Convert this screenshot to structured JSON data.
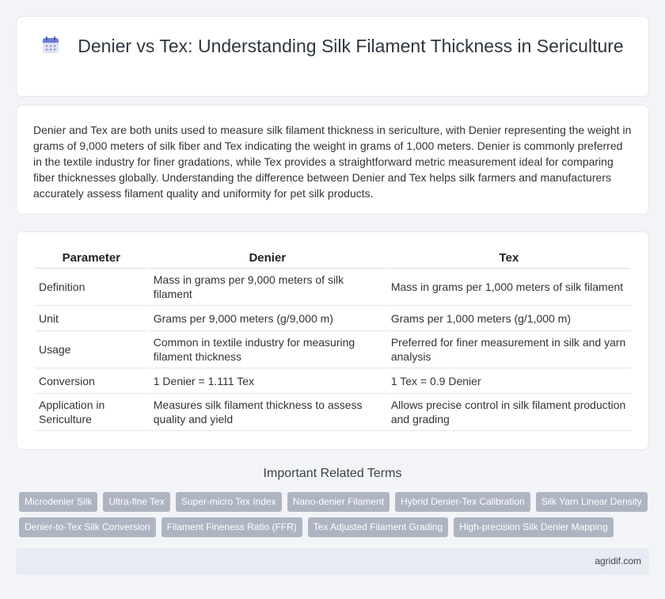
{
  "header": {
    "title": "Denier vs Tex: Understanding Silk Filament Thickness in Sericulture",
    "icon": "calendar-icon"
  },
  "intro": {
    "text": "Denier and Tex are both units used to measure silk filament thickness in sericulture, with Denier representing the weight in grams of 9,000 meters of silk fiber and Tex indicating the weight in grams of 1,000 meters. Denier is commonly preferred in the textile industry for finer gradations, while Tex provides a straightforward metric measurement ideal for comparing fiber thicknesses globally. Understanding the difference between Denier and Tex helps silk farmers and manufacturers accurately assess filament quality and uniformity for pet silk products."
  },
  "table": {
    "headers": [
      "Parameter",
      "Denier",
      "Tex"
    ],
    "rows": [
      [
        "Definition",
        "Mass in grams per 9,000 meters of silk filament",
        "Mass in grams per 1,000 meters of silk filament"
      ],
      [
        "Unit",
        "Grams per 9,000 meters (g/9,000 m)",
        "Grams per 1,000 meters (g/1,000 m)"
      ],
      [
        "Usage",
        "Common in textile industry for measuring filament thickness",
        "Preferred for finer measurement in silk and yarn analysis"
      ],
      [
        "Conversion",
        "1 Denier = 1.111 Tex",
        "1 Tex = 0.9 Denier"
      ],
      [
        "Application in Sericulture",
        "Measures silk filament thickness to assess quality and yield",
        "Allows precise control in silk filament production and grading"
      ]
    ]
  },
  "related": {
    "title": "Important Related Terms",
    "tags_row1": [
      "Microdenier Silk",
      "Ultra-fine Tex",
      "Super-micro Tex Index",
      "Nano-denier Filament",
      "Hybrid Denier-Tex Calibration",
      "Silk Yarn Linear Density"
    ],
    "tags_row2": [
      "Denier-to-Tex Silk Conversion",
      "Filament Fineness Ratio (FFR)",
      "Tex Adjusted Filament Grading",
      "High-precision Silk Denier Mapping"
    ]
  },
  "footer": {
    "site": "agridif.com"
  }
}
